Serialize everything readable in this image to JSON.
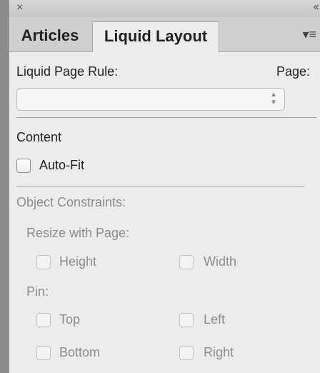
{
  "panel": {
    "close_glyph": "×",
    "collapse_glyph": "‹‹",
    "menu_glyph": "▾≡"
  },
  "tabs": [
    {
      "label": "Articles",
      "active": false
    },
    {
      "label": "Liquid Layout",
      "active": true
    }
  ],
  "liquid_page_rule": {
    "label": "Liquid Page Rule:",
    "page_label": "Page:",
    "selected_value": ""
  },
  "content": {
    "heading": "Content",
    "auto_fit": {
      "label": "Auto-Fit",
      "checked": false
    }
  },
  "object_constraints": {
    "heading": "Object Constraints:",
    "resize_with_page": {
      "label": "Resize with Page:",
      "height": {
        "label": "Height",
        "checked": false
      },
      "width": {
        "label": "Width",
        "checked": false
      }
    },
    "pin": {
      "label": "Pin:",
      "top": {
        "label": "Top",
        "checked": false
      },
      "left": {
        "label": "Left",
        "checked": false
      },
      "bottom": {
        "label": "Bottom",
        "checked": false
      },
      "right": {
        "label": "Right",
        "checked": false
      }
    }
  },
  "colors": {
    "panel_bg": "#ececec",
    "tab_strip_bg": "#cfcfcf",
    "disabled_text": "#8c8c8c"
  }
}
